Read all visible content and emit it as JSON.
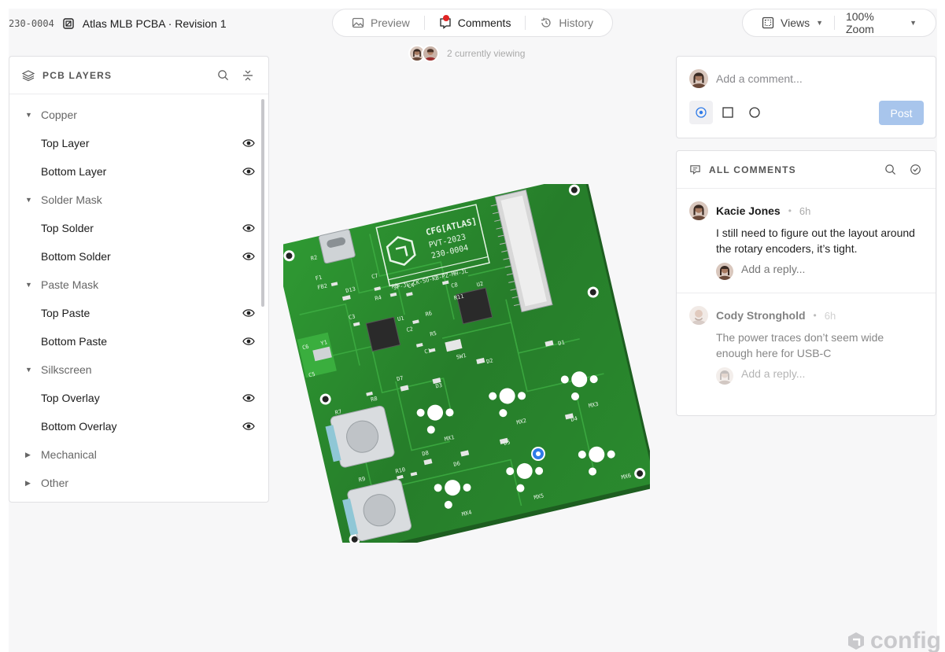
{
  "header": {
    "doc_id": "230-0004",
    "doc_title": "Atlas MLB PCBA · Revision 1",
    "tabs": [
      {
        "label": "Preview",
        "icon": "image-icon"
      },
      {
        "label": "Comments",
        "icon": "comment-icon"
      },
      {
        "label": "History",
        "icon": "history-icon"
      }
    ],
    "active_tab": "Comments",
    "viewing_text": "2 currently viewing",
    "views_label": "Views",
    "zoom_label": "100% Zoom"
  },
  "layers_panel": {
    "title": "PCB LAYERS",
    "groups": [
      {
        "label": "Copper",
        "expanded": true,
        "items": [
          "Top Layer",
          "Bottom Layer"
        ]
      },
      {
        "label": "Solder Mask",
        "expanded": true,
        "items": [
          "Top Solder",
          "Bottom Solder"
        ]
      },
      {
        "label": "Paste Mask",
        "expanded": true,
        "items": [
          "Top Paste",
          "Bottom Paste"
        ]
      },
      {
        "label": "Silkscreen",
        "expanded": true,
        "items": [
          "Top Overlay",
          "Bottom Overlay"
        ]
      },
      {
        "label": "Mechanical",
        "expanded": false,
        "items": []
      },
      {
        "label": "Other",
        "expanded": false,
        "items": []
      }
    ]
  },
  "pcb": {
    "silk_brand": "CFG[ATLAS]",
    "silk_pvt": "PVT-2023",
    "silk_part": "230-0004",
    "silk_initials": "JP-JL-CK-SO-KB-PZ-MH-JL",
    "ref_labels": [
      "R2",
      "F1",
      "FB2",
      "D13",
      "C7",
      "R4",
      "R3",
      "C4",
      "C3",
      "U1",
      "C2",
      "R6",
      "R5",
      "C1",
      "C6",
      "Y1",
      "C5",
      "C8",
      "R11",
      "U2",
      "SW1",
      "D7",
      "R8",
      "R7",
      "D3",
      "D2",
      "D1",
      "MX1",
      "MX2",
      "MX3",
      "R9",
      "R10",
      "D8",
      "D6",
      "D5",
      "D4",
      "MX4",
      "MX5",
      "MX6"
    ],
    "board_color": "#2e8b2e"
  },
  "composer": {
    "placeholder": "Add a comment...",
    "post_label": "Post",
    "tools": [
      "point-icon",
      "rectangle-icon",
      "circle-icon"
    ]
  },
  "comments_panel": {
    "title": "ALL COMMENTS",
    "comments": [
      {
        "author": "Kacie Jones",
        "time": "6h",
        "body": "I still need to figure out the layout around the rotary encoders, it’s tight.",
        "reply_placeholder": "Add a reply...",
        "resolved": false
      },
      {
        "author": "Cody Stronghold",
        "time": "6h",
        "body": "The power traces don’t seem wide enough here for USB-C",
        "reply_placeholder": "Add a reply...",
        "resolved": true
      }
    ]
  },
  "brand": {
    "logo_text": "config"
  }
}
